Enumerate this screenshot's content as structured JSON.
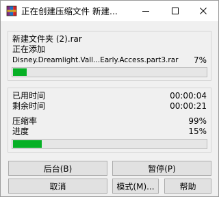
{
  "window": {
    "title": "正在创建压缩文件 新建..."
  },
  "file_section": {
    "archive_name": "新建文件夹 (2).rar",
    "action": "正在添加",
    "current_file": "Disney.Dreamlight.Vall...Early.Access.part3.rar",
    "file_percent_text": "7%",
    "file_progress": 0.07
  },
  "stats": {
    "elapsed_label": "已用时间",
    "elapsed_value": "00:00:04",
    "remaining_label": "剩余时间",
    "remaining_value": "00:00:21",
    "ratio_label": "压缩率",
    "ratio_value": "99%",
    "progress_label": "进度",
    "progress_value": "15%",
    "total_progress": 0.15
  },
  "buttons": {
    "background": "后台(B)",
    "pause": "暂停(P)",
    "cancel": "取消",
    "mode": "模式(M)...",
    "help": "帮助"
  },
  "colors": {
    "progress_fill": "#06b025"
  },
  "icons": {
    "app": "winrar-icon",
    "minimize": "minimize-icon",
    "maximize": "maximize-icon",
    "close": "close-icon"
  }
}
